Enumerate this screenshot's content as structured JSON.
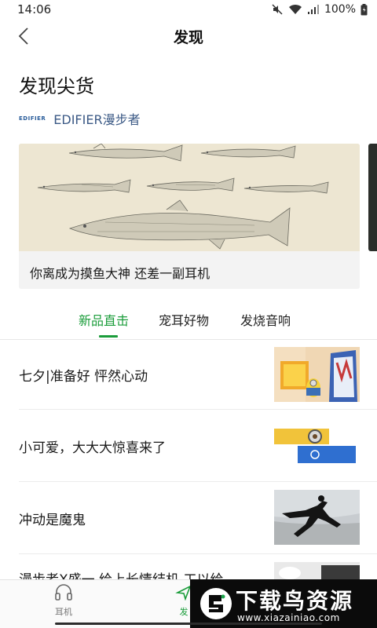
{
  "status_bar": {
    "time": "14:06",
    "battery": "100%"
  },
  "header": {
    "title": "发现"
  },
  "section": {
    "title": "发现尖货"
  },
  "brand": {
    "logo_text": "EDIFIER",
    "name": "EDIFIER漫步者"
  },
  "banner": {
    "caption": "你离成为摸鱼大神 还差一副耳机"
  },
  "tabs": [
    {
      "label": "新品直击",
      "active": true
    },
    {
      "label": "宠耳好物",
      "active": false
    },
    {
      "label": "发烧音响",
      "active": false
    }
  ],
  "articles": [
    {
      "title": "七夕|准备好 怦然心动"
    },
    {
      "title": "小可爱，大大大惊喜来了"
    },
    {
      "title": "冲动是魔鬼"
    },
    {
      "title": "漫步者X盛一 给上长情结机 工以给"
    }
  ],
  "bottom_nav": [
    {
      "label": "耳机",
      "icon": "headphones-icon",
      "active": false
    },
    {
      "label": "发",
      "icon": "discover-icon",
      "active": true
    }
  ],
  "watermark": {
    "title": "下载鸟资源",
    "url": "www.xiazainiao.com"
  },
  "colors": {
    "accent": "#1a9c3a",
    "brand": "#3c5a86"
  }
}
